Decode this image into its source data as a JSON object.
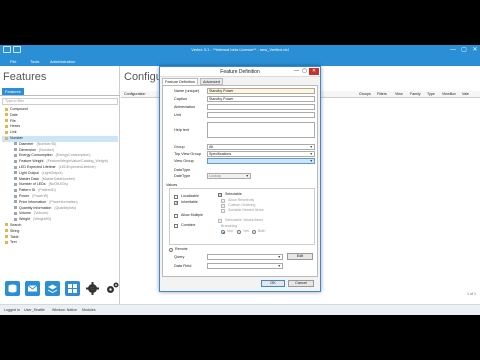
{
  "window": {
    "title": "Vertex 3.1 - **Internal beta License** - new_Verfied.vlcl",
    "minimize": "—",
    "maximize": "▢",
    "close": "✕"
  },
  "menu": [
    "File",
    "Tools",
    "Administration"
  ],
  "left_pane": {
    "heading": "Features",
    "tab": "Features",
    "search_placeholder": "Type to filter",
    "tree": [
      {
        "label": "Compound",
        "meta": ""
      },
      {
        "label": "Date",
        "meta": ""
      },
      {
        "label": "File",
        "meta": ""
      },
      {
        "label": "Hexes",
        "meta": ""
      },
      {
        "label": "Link",
        "meta": ""
      },
      {
        "label": "Number",
        "meta": ""
      },
      {
        "label": "Diameter",
        "meta": "(Number/ID)",
        "child": true
      },
      {
        "label": "Dimension",
        "meta": "(Number)",
        "child": true
      },
      {
        "label": "Energy Consumption",
        "meta": "(EnergyConsumption)",
        "child": true
      },
      {
        "label": "Feature Weight",
        "meta": "(FeatureWeightValue/Catalog_Weight)",
        "child": true
      },
      {
        "label": "LED Expected Lifetime",
        "meta": "(LEDExpectedLifetime)",
        "child": true
      },
      {
        "label": "Light Output",
        "meta": "(LightOutput)",
        "child": true
      },
      {
        "label": "Master Data",
        "meta": "(MasterDataNumber)",
        "child": true
      },
      {
        "label": "Number of LEDs",
        "meta": "(NoOfLEDs)",
        "child": true
      },
      {
        "label": "Pattern ID",
        "meta": "(PatternID)",
        "child": true
      },
      {
        "label": "Power",
        "meta": "(PowerW)",
        "child": true
      },
      {
        "label": "Price Information",
        "meta": "(PriceInformation)",
        "child": true
      },
      {
        "label": "Quantity Information",
        "meta": "(QuantityInfo)",
        "child": true
      },
      {
        "label": "Volume",
        "meta": "(Volume)",
        "child": true
      },
      {
        "label": "Weight",
        "meta": "(Weight/ID)",
        "child": true
      },
      {
        "label": "Search",
        "meta": ""
      },
      {
        "label": "String",
        "meta": ""
      },
      {
        "label": "Table",
        "meta": ""
      },
      {
        "label": "Text",
        "meta": ""
      }
    ]
  },
  "right_pane": {
    "heading": "Configura",
    "columns": [
      "Configuration",
      "Groups",
      "Filters",
      "View",
      "Family",
      "Type",
      "ViewBox",
      "Vale"
    ],
    "pager": "1 of 1"
  },
  "status_bar": [
    "Logged In",
    "User_Seattle",
    "Window: Native",
    "Modules"
  ],
  "dialog": {
    "title": "Feature Definition",
    "tabs": [
      "Feature Definition",
      "Advanced"
    ],
    "labels": {
      "name": "Name (unique)",
      "caption": "Caption",
      "abbreviation": "Abbreviation",
      "unit": "Unit",
      "help_text": "Help text",
      "group": "Group",
      "top_view_group": "Top View Group",
      "view_group": "View Group",
      "data_type": "DataType",
      "date_type": "DateType",
      "values": "Values",
      "remote": "Remote",
      "query": "Query",
      "data_field": "Data Field"
    },
    "fields": {
      "name": "Standby Power",
      "caption": "Standby Power",
      "abbreviation": "",
      "unit": "",
      "help_text": "",
      "group": "Alt",
      "top_view_group": "Specifications",
      "view_group": "",
      "data_type": "",
      "date_type": "Lookup",
      "query": "",
      "data_field": ""
    },
    "checkboxes": {
      "localizable": "Localizable",
      "selectable": "Selectable",
      "inheritable": "Inheritable",
      "allow_reselectly": "Allow Reselectly",
      "custom_ordering": "Custom Ordering",
      "sortable_nested": "Sortable Nested Items",
      "allow_multiple": "Allow Multiple",
      "combine": "Combine",
      "selectable_values": "Selectable Values items",
      "branching": "Branching"
    },
    "radios": [
      "Not",
      "Yes",
      "Both"
    ],
    "buttons": {
      "edit": "Edit",
      "ok": "OK",
      "cancel": "Cancel"
    }
  },
  "colors": {
    "accent": "#2b8fd6",
    "close": "#c7302b",
    "selection": "#cde6f7"
  }
}
